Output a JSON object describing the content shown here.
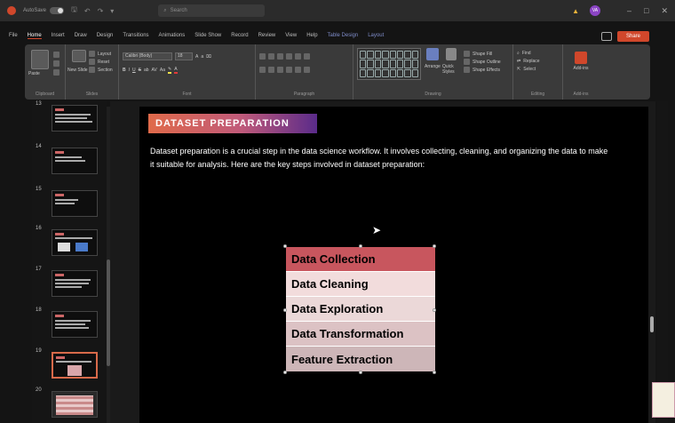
{
  "title_bar": {
    "autosave_label": "AutoSave",
    "search_placeholder": "Search",
    "user_initials": "VA"
  },
  "ribbon_tabs": [
    "File",
    "Home",
    "Insert",
    "Draw",
    "Design",
    "Transitions",
    "Animations",
    "Slide Show",
    "Record",
    "Review",
    "View",
    "Help",
    "Table Design",
    "Layout"
  ],
  "active_tab": "Home",
  "share_label": "Share",
  "ribbon_groups": [
    "Clipboard",
    "Slides",
    "Font",
    "Paragraph",
    "Drawing",
    "Editing",
    "Add-ins"
  ],
  "ribbon_items": {
    "paste": "Paste",
    "new_slide": "New Slide",
    "layout": "Layout",
    "reset": "Reset",
    "section": "Section",
    "font_name": "Calibri (Body)",
    "font_size": "18",
    "arrange": "Arrange",
    "quick_styles": "Quick Styles",
    "shape_fill": "Shape Fill",
    "shape_outline": "Shape Outline",
    "shape_effects": "Shape Effects",
    "find": "Find",
    "replace": "Replace",
    "select": "Select",
    "add_ins": "Add-ins"
  },
  "slide_numbers": [
    "13",
    "14",
    "15",
    "16",
    "17",
    "18",
    "19",
    "20"
  ],
  "selected_slide": "19",
  "slide": {
    "title": "DATASET PREPARATION",
    "body": "Dataset preparation is a crucial step in the data science workflow. It involves collecting, cleaning, and organizing the data to make it suitable for analysis. Here are the key steps involved in dataset preparation:",
    "steps": [
      "Data Collection",
      "Data Cleaning",
      "Data Exploration",
      "Data Transformation",
      "Feature Extraction"
    ]
  },
  "colors": {
    "accent": "#d0472b",
    "step_rows": [
      "#c8565e",
      "#f2dcdc",
      "#ebd8d8",
      "#dcc2c4",
      "#cdb6b8"
    ]
  }
}
